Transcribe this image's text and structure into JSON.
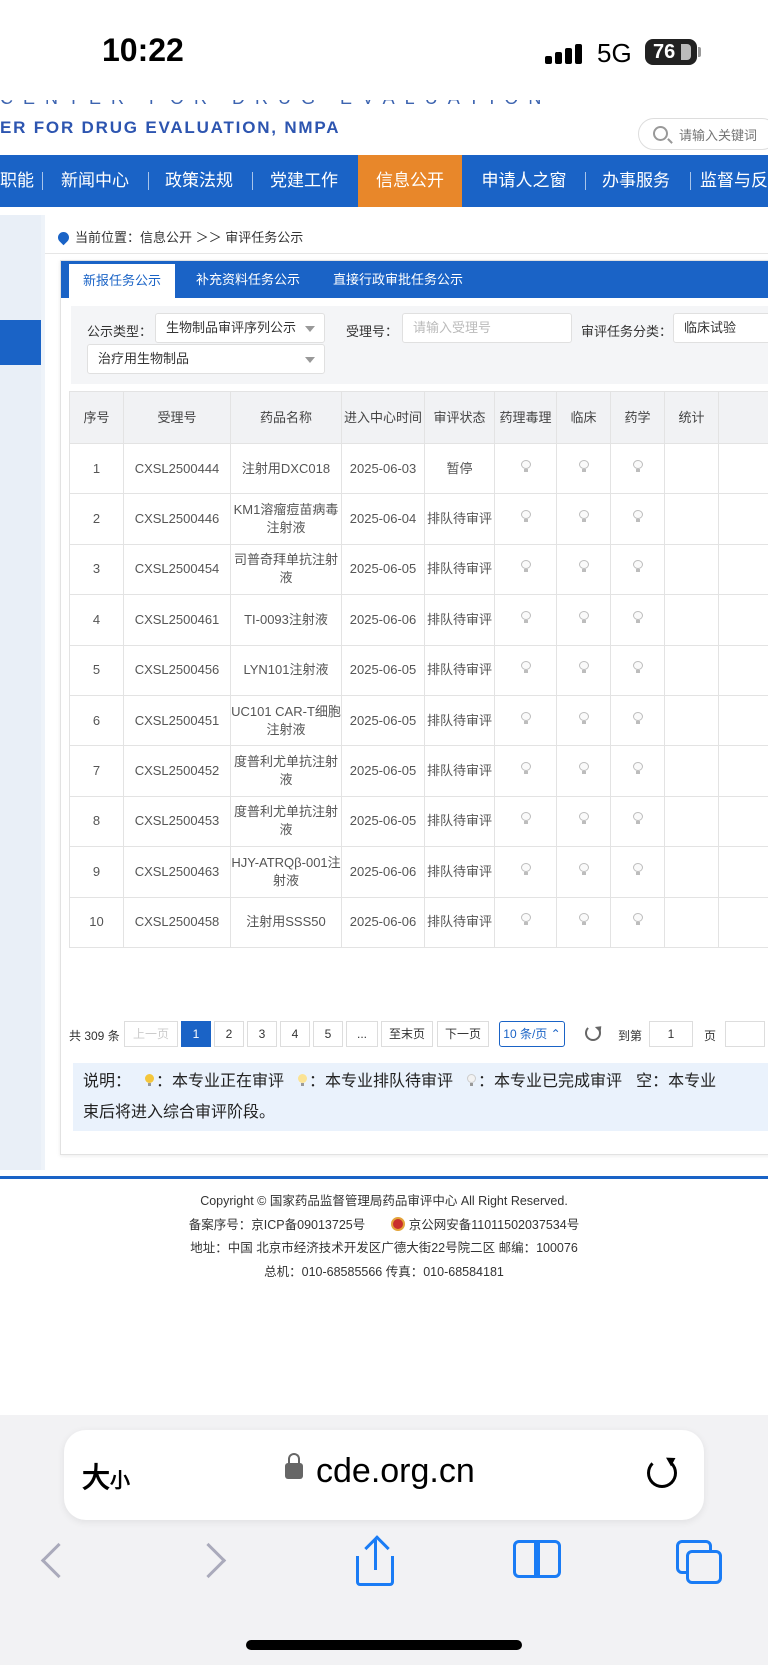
{
  "status_bar": {
    "time": "10:22",
    "network": "5G",
    "battery": "76"
  },
  "header": {
    "cut_title": "CENTER FOR DRUG EVALUATION",
    "subtitle": "ER FOR DRUG EVALUATION, NMPA",
    "search_placeholder": "请输入关键词"
  },
  "nav": {
    "items": [
      "职能",
      "新闻中心",
      "政策法规",
      "党建工作",
      "信息公开",
      "申请人之窗",
      "办事服务",
      "监督与反"
    ],
    "active": "信息公开"
  },
  "breadcrumb": "当前位置：信息公开 ＞＞ 审评任务公示",
  "tabs": [
    "新报任务公示",
    "补充资料任务公示",
    "直接行政审批任务公示"
  ],
  "filters": {
    "type_label": "公示类型：",
    "type_value": "生物制品审评序列公示",
    "accept_label": "受理号：",
    "accept_placeholder": "请输入受理号",
    "category_label": "审评任务分类：",
    "category_value": "临床试验",
    "sub_value": "治疗用生物制品"
  },
  "table": {
    "headers": [
      "序号",
      "受理号",
      "药品名称",
      "进入中心时间",
      "审评状态",
      "药理毒理",
      "临床",
      "药学",
      "统计"
    ],
    "rows": [
      {
        "no": "1",
        "id": "CXSL2500444",
        "name": "注射用DXC018",
        "date": "2025-06-03",
        "status": "暂停"
      },
      {
        "no": "2",
        "id": "CXSL2500446",
        "name": "KM1溶瘤痘苗病毒注射液",
        "date": "2025-06-04",
        "status": "排队待审评"
      },
      {
        "no": "3",
        "id": "CXSL2500454",
        "name": "司普奇拜单抗注射液",
        "date": "2025-06-05",
        "status": "排队待审评"
      },
      {
        "no": "4",
        "id": "CXSL2500461",
        "name": "TI-0093注射液",
        "date": "2025-06-06",
        "status": "排队待审评"
      },
      {
        "no": "5",
        "id": "CXSL2500456",
        "name": "LYN101注射液",
        "date": "2025-06-05",
        "status": "排队待审评"
      },
      {
        "no": "6",
        "id": "CXSL2500451",
        "name": "UC101 CAR-T细胞注射液",
        "date": "2025-06-05",
        "status": "排队待审评"
      },
      {
        "no": "7",
        "id": "CXSL2500452",
        "name": "度普利尤单抗注射液",
        "date": "2025-06-05",
        "status": "排队待审评"
      },
      {
        "no": "8",
        "id": "CXSL2500453",
        "name": "度普利尤单抗注射液",
        "date": "2025-06-05",
        "status": "排队待审评"
      },
      {
        "no": "9",
        "id": "CXSL2500463",
        "name": "HJY-ATRQβ-001注射液",
        "date": "2025-06-06",
        "status": "排队待审评"
      },
      {
        "no": "10",
        "id": "CXSL2500458",
        "name": "注射用SSS50",
        "date": "2025-06-06",
        "status": "排队待审评"
      }
    ]
  },
  "pager": {
    "total": "共 309 条",
    "prev": "上一页",
    "pages": [
      "1",
      "2",
      "3",
      "4",
      "5",
      "..."
    ],
    "last": "至末页",
    "next": "下一页",
    "size": "10 条/页",
    "goto": "到第",
    "goto_value": "1",
    "page_unit": "页"
  },
  "note": {
    "prefix": "说明：",
    "s1": "：本专业正在审评",
    "s2": "：本专业排队待审评",
    "s3": "：本专业已完成审评",
    "s4": "空：本专业",
    "line2": "束后将进入综合审评阶段。"
  },
  "footer": {
    "copyright": "Copyright © 国家药品监督管理局药品审评中心    All Right Reserved.",
    "icp": "备案序号：京ICP备09013725号",
    "police": "京公网安备11011502037534号",
    "address": "地址：中国 北京市经济技术开发区广德大街22号院二区        邮编：100076",
    "phone": "总机：010-68585566        传真：010-68584181"
  },
  "browser": {
    "text_size": "大",
    "text_size_small": "小",
    "url": "cde.org.cn"
  },
  "colors": {
    "primary": "#1a63c6",
    "nav_active": "#e8872a"
  }
}
